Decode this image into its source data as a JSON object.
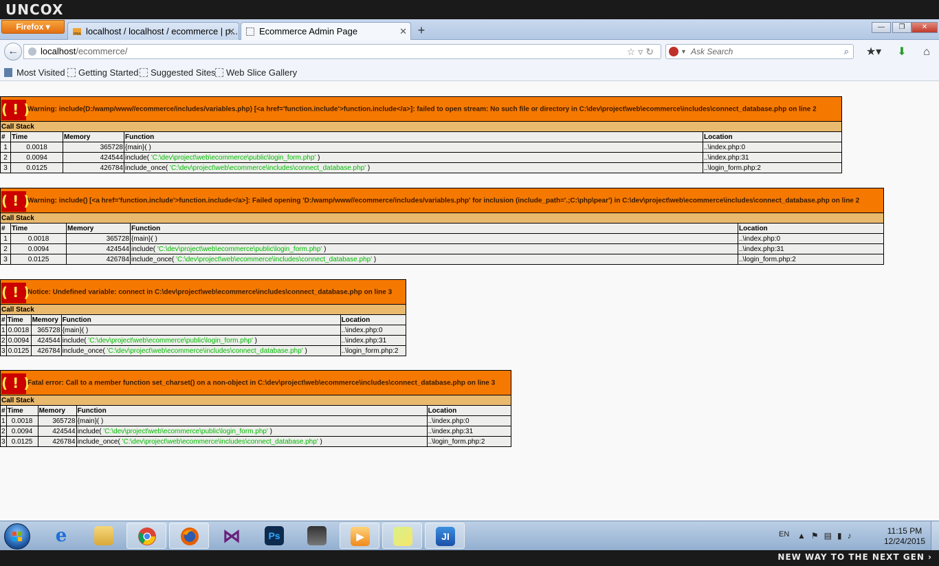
{
  "brand": {
    "logo": "UNCOX",
    "slogan": "NEW WAY TO THE NEXT GEN ›"
  },
  "browser": {
    "app_button": "Firefox ▾",
    "tabs": [
      {
        "title": "localhost / localhost / ecommerce | p...",
        "favicon": "phpmyadmin-icon"
      },
      {
        "title": "Ecommerce Admin Page",
        "favicon": "blank-page-icon"
      }
    ],
    "new_tab": "+",
    "window_controls": {
      "minimize": "—",
      "restore": "❐",
      "close": "✕"
    },
    "url": {
      "host": "localhost",
      "path": "/ecommerce/"
    },
    "search_placeholder": "Ask Search",
    "bookmarks": [
      "Most Visited",
      "Getting Started",
      "Suggested Sites",
      "Web Slice Gallery"
    ]
  },
  "errors": [
    {
      "message": "Warning: include(D:/wamp/www//ecommerce/includes/variables.php) [<a href='function.include'>function.include</a>]: failed to open stream: No such file or directory in C:\\dev\\project\\web\\ecommerce\\includes\\connect_database.php on line 2",
      "call_stack_label": "Call Stack",
      "headers": [
        "#",
        "Time",
        "Memory",
        "Function",
        "Location"
      ],
      "rows": [
        {
          "n": "1",
          "time": "0.0018",
          "memory": "365728",
          "func": "{main}( )",
          "arg": "",
          "func_end": "",
          "location": "..\\index.php:0"
        },
        {
          "n": "2",
          "time": "0.0094",
          "memory": "424544",
          "func": "include( ",
          "arg": "'C:\\dev\\project\\web\\ecommerce\\public\\login_form.php'",
          "func_end": " )",
          "location": "..\\index.php:31"
        },
        {
          "n": "3",
          "time": "0.0125",
          "memory": "426784",
          "func": "include_once( ",
          "arg": "'C:\\dev\\project\\web\\ecommerce\\includes\\connect_database.php'",
          "func_end": " )",
          "location": "..\\login_form.php:2"
        }
      ]
    },
    {
      "message": "Warning: include() [<a href='function.include'>function.include</a>]: Failed opening 'D:/wamp/www//ecommerce/includes/variables.php' for inclusion (include_path='.;C:\\php\\pear') in C:\\dev\\project\\web\\ecommerce\\includes\\connect_database.php on line 2",
      "call_stack_label": "Call Stack",
      "headers": [
        "#",
        "Time",
        "Memory",
        "Function",
        "Location"
      ],
      "rows": [
        {
          "n": "1",
          "time": "0.0018",
          "memory": "365728",
          "func": "{main}( )",
          "arg": "",
          "func_end": "",
          "location": "..\\index.php:0"
        },
        {
          "n": "2",
          "time": "0.0094",
          "memory": "424544",
          "func": "include( ",
          "arg": "'C:\\dev\\project\\web\\ecommerce\\public\\login_form.php'",
          "func_end": " )",
          "location": "..\\index.php:31"
        },
        {
          "n": "3",
          "time": "0.0125",
          "memory": "426784",
          "func": "include_once( ",
          "arg": "'C:\\dev\\project\\web\\ecommerce\\includes\\connect_database.php'",
          "func_end": " )",
          "location": "..\\login_form.php:2"
        }
      ]
    },
    {
      "message": "Notice: Undefined variable: connect in C:\\dev\\project\\web\\ecommerce\\includes\\connect_database.php on line 3",
      "call_stack_label": "Call Stack",
      "headers": [
        "#",
        "Time",
        "Memory",
        "Function",
        "Location"
      ],
      "rows": [
        {
          "n": "1",
          "time": "0.0018",
          "memory": "365728",
          "func": "{main}( )",
          "arg": "",
          "func_end": "",
          "location": "..\\index.php:0"
        },
        {
          "n": "2",
          "time": "0.0094",
          "memory": "424544",
          "func": "include( ",
          "arg": "'C:\\dev\\project\\web\\ecommerce\\public\\login_form.php'",
          "func_end": " )",
          "location": "..\\index.php:31"
        },
        {
          "n": "3",
          "time": "0.0125",
          "memory": "426784",
          "func": "include_once( ",
          "arg": "'C:\\dev\\project\\web\\ecommerce\\includes\\connect_database.php'",
          "func_end": " )",
          "location": "..\\login_form.php:2"
        }
      ]
    },
    {
      "message": "Fatal error: Call to a member function set_charset() on a non-object in C:\\dev\\project\\web\\ecommerce\\includes\\connect_database.php on line 3",
      "call_stack_label": "Call Stack",
      "headers": [
        "#",
        "Time",
        "Memory",
        "Function",
        "Location"
      ],
      "rows": [
        {
          "n": "1",
          "time": "0.0018",
          "memory": "365728",
          "func": "{main}( )",
          "arg": "",
          "func_end": "",
          "location": "..\\index.php:0"
        },
        {
          "n": "2",
          "time": "0.0094",
          "memory": "424544",
          "func": "include( ",
          "arg": "'C:\\dev\\project\\web\\ecommerce\\public\\login_form.php'",
          "func_end": " )",
          "location": "..\\index.php:31"
        },
        {
          "n": "3",
          "time": "0.0125",
          "memory": "426784",
          "func": "include_once( ",
          "arg": "'C:\\dev\\project\\web\\ecommerce\\includes\\connect_database.php'",
          "func_end": " )",
          "location": "..\\login_form.php:2"
        }
      ]
    }
  ],
  "error_icon_text": "( ! )",
  "taskbar": {
    "apps": [
      "start-orb",
      "internet-explorer-icon",
      "file-explorer-icon",
      "chrome-icon",
      "firefox-icon",
      "visual-studio-icon",
      "photoshop-icon",
      "pes-game-icon",
      "media-player-icon",
      "sticky-notes-icon",
      "jetbrains-icon"
    ],
    "photoshop_label": "Ps",
    "jetbrains_label": "JI",
    "language": "EN",
    "time": "11:15 PM",
    "date": "12/24/2015"
  },
  "colors": {
    "error_orange": "#f57900",
    "call_stack_tan": "#e9b96e",
    "row_grey": "#eeeeec",
    "path_green": "#00bb00",
    "bang_red": "#cc0000"
  }
}
